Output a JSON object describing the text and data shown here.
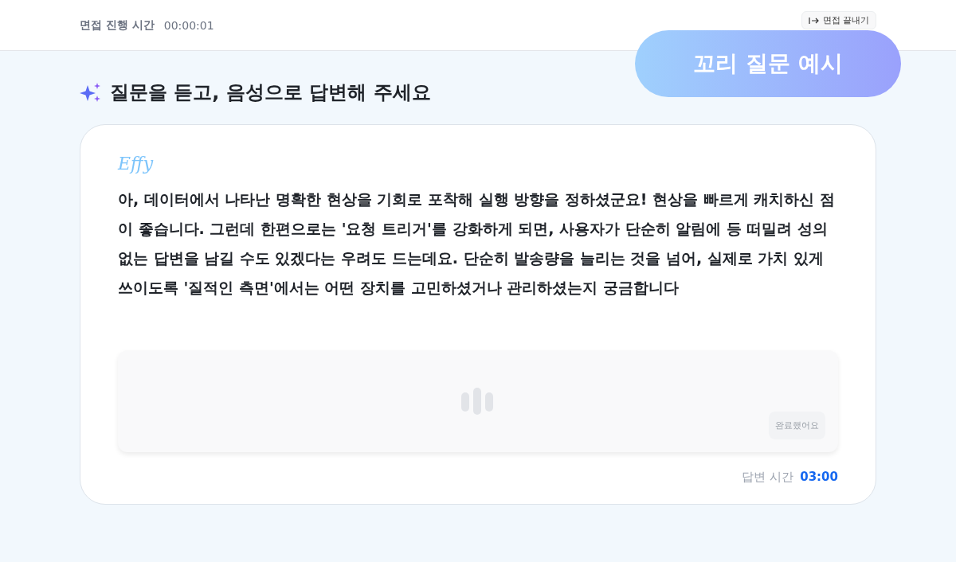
{
  "header": {
    "label": "면접 진행 시간",
    "elapsed": "00:00:01",
    "end_button": "면접 끝내기"
  },
  "floating_badge": "꼬리 질문 예시",
  "heading": "질문을 듣고, 음성으로 답변해 주세요",
  "card": {
    "speaker": "Effy",
    "question": "아, 데이터에서 나타난 명확한 현상을 기회로 포착해 실행 방향을 정하셨군요! 현상을 빠르게 캐치하신 점이 좋습니다. 그런데 한편으로는 '요청 트리거'를 강화하게 되면, 사용자가 단순히 알림에 등 떠밀려 성의 없는 답변을 남길 수도 있겠다는 우려도 드는데요. 단순히 발송량을 늘리는 것을 넘어, 실제로 가치 있게 쓰이도록 '질적인 측면'에서는 어떤 장치를 고민하셨거나 관리하셨는지 궁금합니다",
    "done_button": {
      "label": "완료했어요",
      "disabled": true
    },
    "answer_time_label": "답변 시간",
    "answer_time": "03:00"
  }
}
